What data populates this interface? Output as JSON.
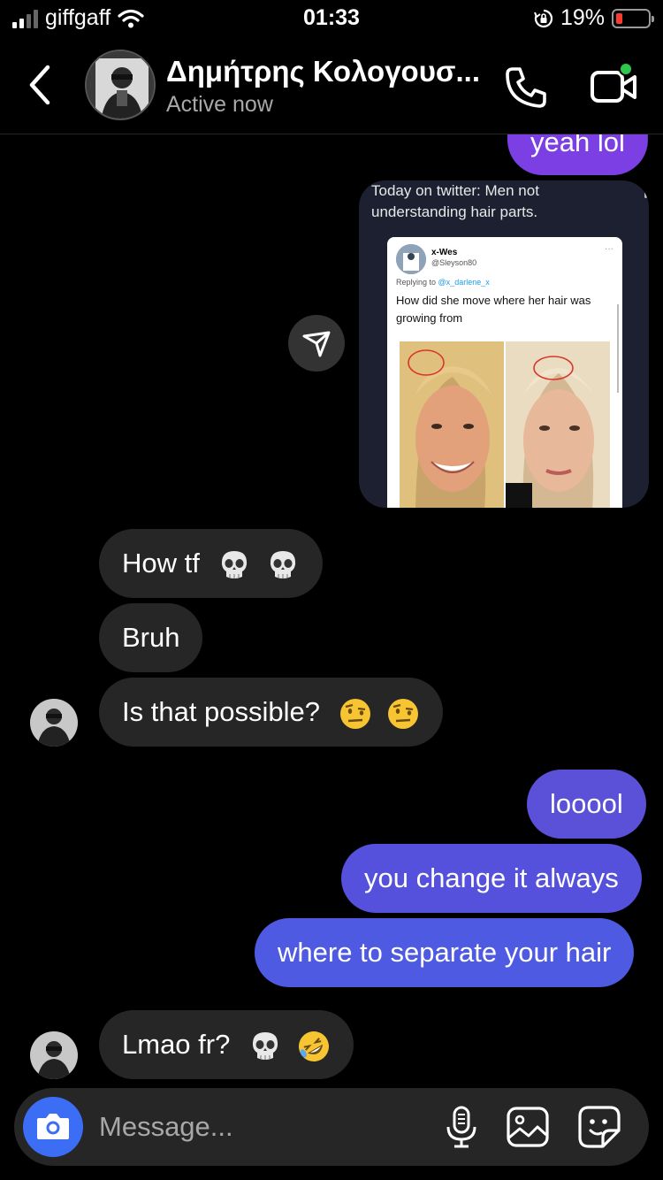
{
  "status_bar": {
    "carrier": "giffgaff",
    "time": "01:33",
    "battery_percent": "19%",
    "battery_level": 0.19,
    "battery_color": "#ff3b30"
  },
  "header": {
    "contact_name": "Δημήτρης Κολογουσ...",
    "presence": "Active now",
    "online_indicator_color": "#2ec74e"
  },
  "conversation": {
    "outgoing_top": {
      "text": "yeah lol"
    },
    "shared_post": {
      "caption": "Today on twitter: Men not understanding hair parts.",
      "tweet": {
        "author": "x-Wes",
        "handle": "@Sleyson80",
        "more": "···",
        "replying_prefix": "Replying to",
        "replying_to": "@x_darlene_x",
        "text": "How did she move where her hair was growing from"
      }
    },
    "incoming_group_1": [
      {
        "text": "How tf",
        "emojis": [
          "skull-emoji",
          "skull-emoji"
        ]
      },
      {
        "text": "Bruh",
        "emojis": []
      },
      {
        "text": "Is that possible?",
        "emojis": [
          "raised-eyebrow-emoji",
          "raised-eyebrow-emoji"
        ]
      }
    ],
    "outgoing_group": [
      {
        "text": "looool"
      },
      {
        "text": "you change it always"
      },
      {
        "text": "where to separate your hair"
      }
    ],
    "incoming_group_2": [
      {
        "text": "Lmao fr?",
        "emojis": [
          "skull-emoji",
          "rolling-laughing-emoji"
        ]
      }
    ]
  },
  "composer": {
    "placeholder": "Message...",
    "icons": [
      "camera-icon",
      "microphone-icon",
      "gallery-icon",
      "sticker-icon"
    ],
    "camera_color": "#3b6ef5"
  },
  "colors": {
    "outgoing_light": "#5b51d8",
    "outgoing_top": "#7b3fe4",
    "incoming": "#262626",
    "background": "#000000"
  }
}
